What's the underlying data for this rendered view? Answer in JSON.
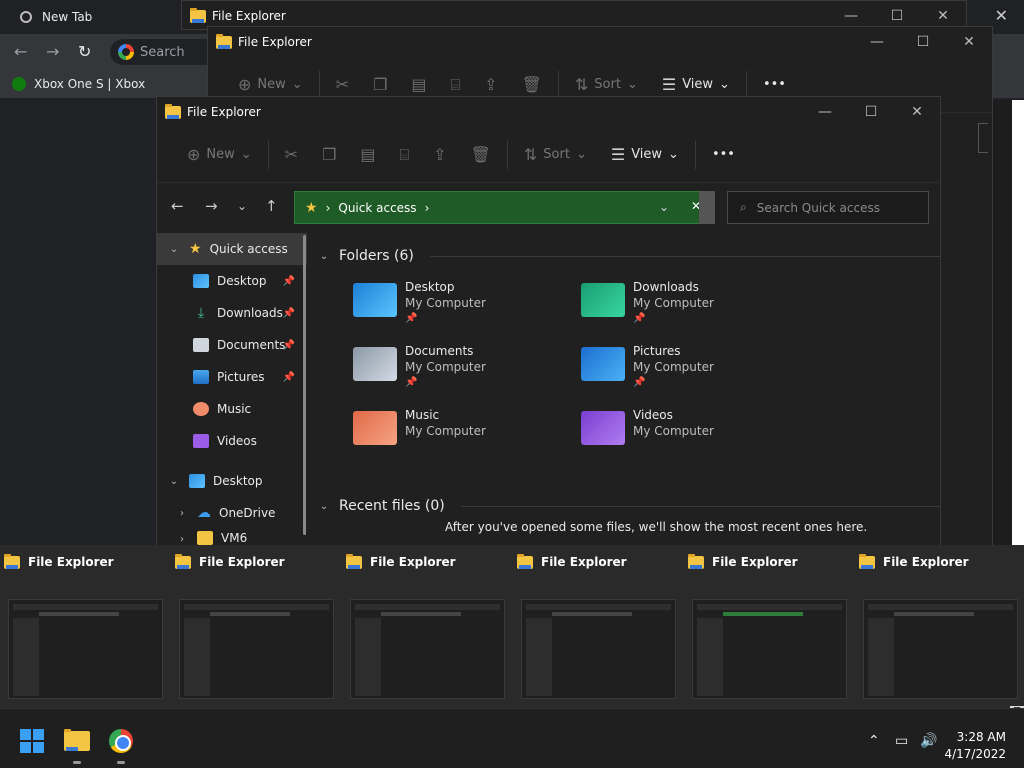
{
  "chrome": {
    "tab_title": "New Tab",
    "omnibox_text": "Search",
    "bookmark": "Xbox One S | Xbox",
    "close": "✕"
  },
  "back_windows": [
    {
      "title": "File Explorer"
    },
    {
      "title": "File Explorer"
    }
  ],
  "explorer": {
    "title": "File Explorer",
    "controls": {
      "minimize": "—",
      "maximize": "☐",
      "close": "✕"
    },
    "commands": {
      "new": "New",
      "sort": "Sort",
      "view": "View",
      "more": "•••"
    },
    "address": {
      "location": "Quick access",
      "sep": "›"
    },
    "search_placeholder": "Search Quick access",
    "nav": {
      "quick_access": "Quick access",
      "items": [
        "Desktop",
        "Downloads",
        "Documents",
        "Pictures",
        "Music",
        "Videos"
      ],
      "desktop_root": "Desktop",
      "onedrive": "OneDrive",
      "vm": "VM6"
    },
    "folders_header": "Folders (6)",
    "folders": [
      {
        "name": "Desktop",
        "location": "My Computer"
      },
      {
        "name": "Downloads",
        "location": "My Computer"
      },
      {
        "name": "Documents",
        "location": "My Computer"
      },
      {
        "name": "Pictures",
        "location": "My Computer"
      },
      {
        "name": "Music",
        "location": "My Computer"
      },
      {
        "name": "Videos",
        "location": "My Computer"
      }
    ],
    "recent_header": "Recent files (0)",
    "recent_message": "After you've opened some files, we'll show the most recent ones here."
  },
  "thumbnails": [
    {
      "title": "File Explorer"
    },
    {
      "title": "File Explorer"
    },
    {
      "title": "File Explorer"
    },
    {
      "title": "File Explorer"
    },
    {
      "title": "File Explorer"
    },
    {
      "title": "File Explorer"
    }
  ],
  "taskbar": {
    "time": "3:28 AM",
    "date": "4/17/2022"
  },
  "colors": {
    "address_bg": "#1e5b26",
    "accent": "#3aa0f3"
  }
}
